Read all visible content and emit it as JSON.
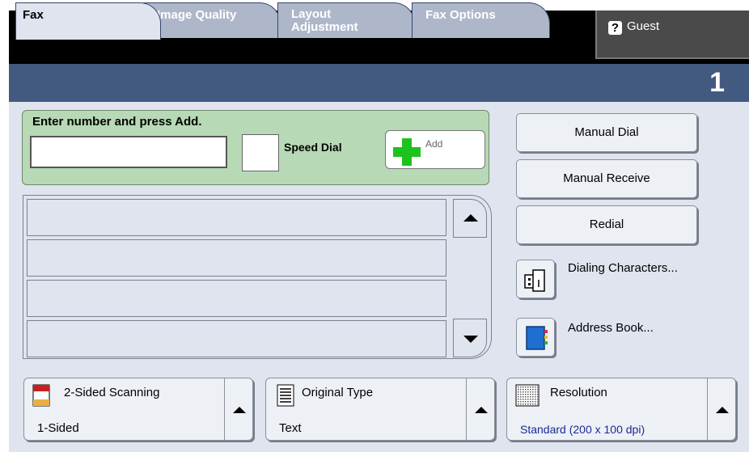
{
  "header": {
    "user_label": "Guest",
    "user_icon": "help-question-icon"
  },
  "tabs": [
    {
      "label": "Fax",
      "active": true
    },
    {
      "label": "Image Quality",
      "active": false
    },
    {
      "label": "Layout\nAdjustment",
      "active": false
    },
    {
      "label": "Fax Options",
      "active": false
    }
  ],
  "tab_number": "1",
  "entry": {
    "title": "Enter number and press Add.",
    "number_value": "",
    "speed_dial_label": "Speed Dial",
    "add_label": "Add",
    "add_color": "#1ec21e"
  },
  "recipient_list": {
    "rows": [
      "",
      "",
      "",
      ""
    ]
  },
  "right_buttons": {
    "manual_dial": "Manual Dial",
    "manual_receive": "Manual Receive",
    "redial": "Redial",
    "dialing_characters": "Dialing Characters...",
    "address_book": "Address Book..."
  },
  "footer": {
    "two_sided": {
      "title": "2-Sided Scanning",
      "value": "1-Sided"
    },
    "original_type": {
      "title": "Original Type",
      "value": "Text"
    },
    "resolution": {
      "title": "Resolution",
      "value": "Standard (200 x 100 dpi)"
    }
  },
  "colors": {
    "tabbar": "#435a80",
    "panel": "#dfe4ef",
    "entry_bg": "#b7d9b5"
  }
}
